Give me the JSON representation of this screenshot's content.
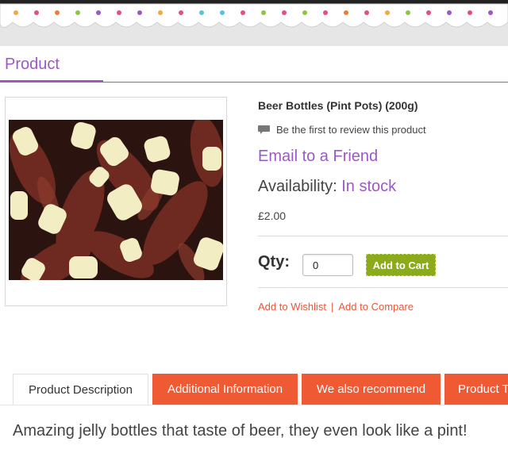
{
  "page": {
    "heading": "Product"
  },
  "product": {
    "name": "Beer Bottles (Pint Pots) (200g)",
    "review_prompt": "Be the first to review this product",
    "email_link": "Email to a Friend",
    "availability_label": "Availability:",
    "availability_value": "In stock",
    "price": "£2.00",
    "qty_label": "Qty:",
    "qty_value": "0",
    "add_to_cart": "Add to Cart",
    "wishlist": "Add to Wishlist",
    "link_separator": "|",
    "compare": "Add to Compare"
  },
  "tabs": [
    {
      "label": "Product Description"
    },
    {
      "label": "Additional Information"
    },
    {
      "label": "We also recommend"
    },
    {
      "label": "Product T"
    }
  ],
  "description": "Amazing jelly bottles that taste of beer, they even look like a pint!",
  "colors": {
    "accent": "#9b59c6",
    "tab_orange": "#ef5a35",
    "cart_green": "#8cab1a",
    "link_orange": "#e8573a"
  },
  "icons": {
    "review": "speech-bubble-icon"
  }
}
